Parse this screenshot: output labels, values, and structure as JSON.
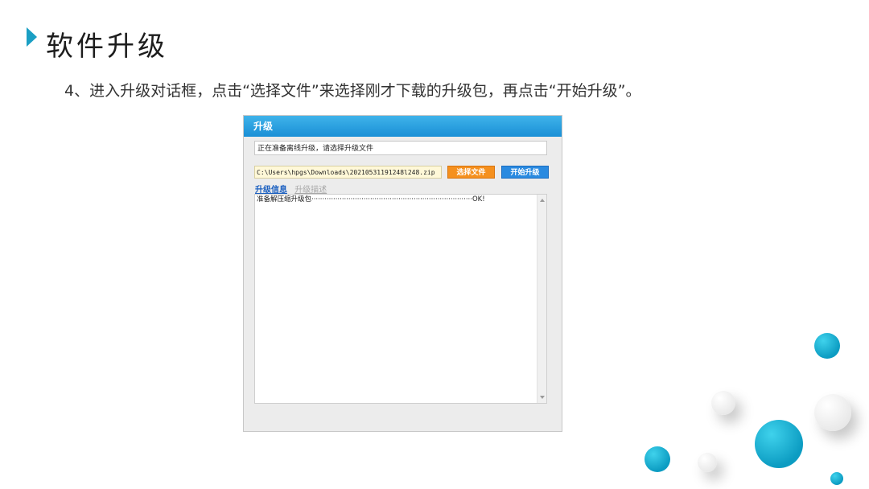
{
  "slide": {
    "title": "软件升级",
    "instruction": "4、进入升级对话框，点击“选择文件”来选择刚才下载的升级包，再点击“开始升级”。",
    "accent_color": "#1a9fc4"
  },
  "dialog": {
    "title": "升级",
    "status_text": "正在准备离线升级，请选择升级文件",
    "file_path": "C:\\Users\\hpgs\\Downloads\\20210531191248l248.zip",
    "select_button_label": "选择文件",
    "start_button_label": "开始升级",
    "tabs": [
      {
        "label": "升级信息",
        "active": true
      },
      {
        "label": "升级描述",
        "active": false
      }
    ],
    "log_lines": [
      "准备解压缩升级包··········································································OK!"
    ],
    "colors": {
      "titlebar": "#1a8fd6",
      "select_button": "#f5901e",
      "start_button": "#2a8ae0"
    }
  }
}
